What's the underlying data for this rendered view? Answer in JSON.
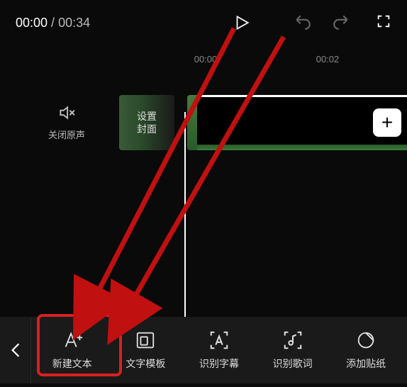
{
  "top": {
    "current_time": "00:00",
    "total_time": "00:34"
  },
  "timeline": {
    "marks": [
      "00:00",
      "00:02"
    ],
    "mute_label": "关闭原声",
    "cover_line1": "设置",
    "cover_line2": "封面",
    "add_clip_label": "+"
  },
  "tools": [
    {
      "id": "new-text",
      "label": "新建文本"
    },
    {
      "id": "text-template",
      "label": "文字模板"
    },
    {
      "id": "auto-caption",
      "label": "识别字幕"
    },
    {
      "id": "auto-lyrics",
      "label": "识别歌词"
    },
    {
      "id": "add-sticker",
      "label": "添加贴纸"
    }
  ],
  "colors": {
    "highlight": "#d92020",
    "bg": "#0a0a0a",
    "bar_bg": "#1a1a1a"
  }
}
